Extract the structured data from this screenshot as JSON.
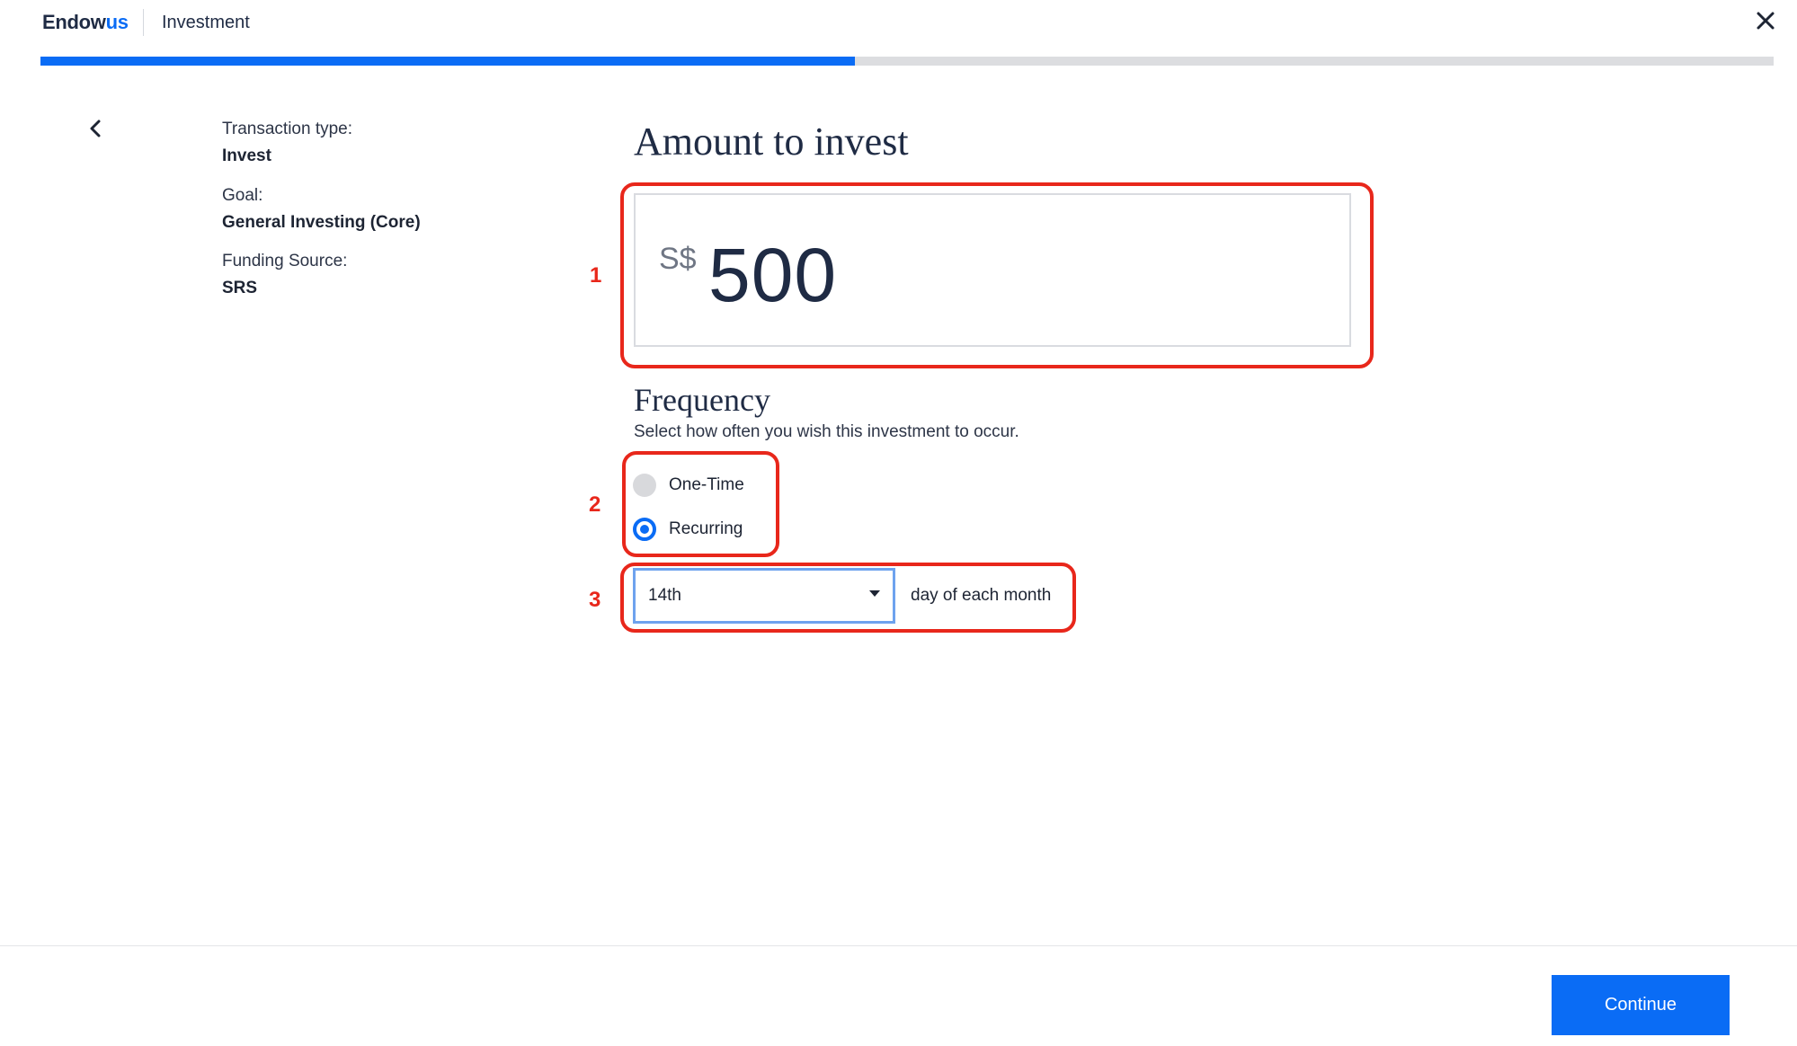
{
  "header": {
    "logo_main": "Endow",
    "logo_accent": "us",
    "section_title": "Investment"
  },
  "progress": {
    "fraction": 0.47
  },
  "summary": {
    "transaction_type_label": "Transaction type:",
    "transaction_type_value": "Invest",
    "goal_label": "Goal:",
    "goal_value": "General Investing (Core)",
    "funding_label": "Funding Source:",
    "funding_value": "SRS"
  },
  "amount": {
    "heading": "Amount to invest",
    "currency": "S$",
    "value": "500"
  },
  "frequency": {
    "heading": "Frequency",
    "subtitle": "Select how often you wish this investment to occur.",
    "options": [
      {
        "label": "One-Time",
        "selected": false
      },
      {
        "label": "Recurring",
        "selected": true
      }
    ],
    "day_selected": "14th",
    "day_suffix": "day of each month"
  },
  "annotations": [
    "1",
    "2",
    "3"
  ],
  "footer": {
    "continue_label": "Continue"
  },
  "colors": {
    "accent": "#0a6cf5",
    "annotation": "#e8271b"
  },
  "icons": [
    "close-icon",
    "back-chevron-icon",
    "dropdown-caret-icon"
  ]
}
